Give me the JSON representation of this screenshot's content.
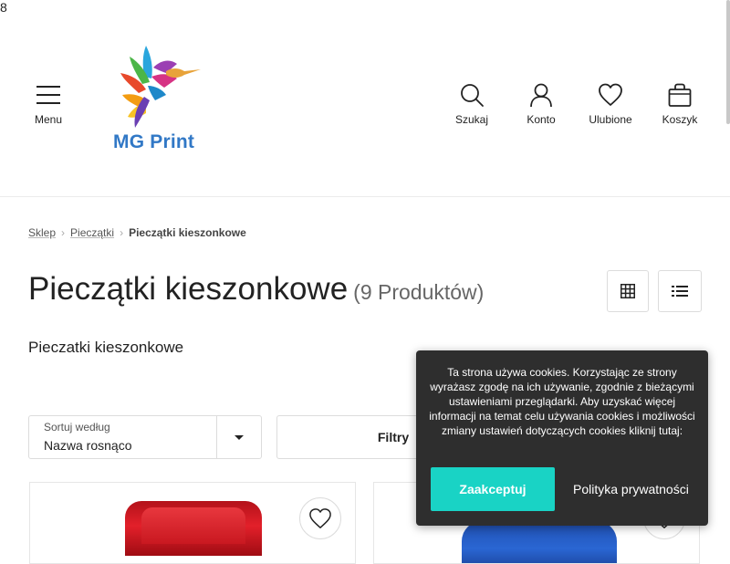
{
  "stray_char": "8",
  "header": {
    "menu_label": "Menu",
    "logo_text": "MG Print",
    "search_label": "Szukaj",
    "account_label": "Konto",
    "favorites_label": "Ulubione",
    "cart_label": "Koszyk"
  },
  "breadcrumb": {
    "items": [
      "Sklep",
      "Pieczątki"
    ],
    "current": "Pieczątki kieszonkowe"
  },
  "page": {
    "title": "Pieczątki kieszonkowe",
    "count": "(9 Produktów)",
    "description": "Pieczatki kieszonkowe"
  },
  "sort": {
    "label": "Sortuj według",
    "value": "Nazwa rosnąco"
  },
  "filters_label": "Filtry",
  "cookie": {
    "text": "Ta strona używa cookies. Korzystając ze strony wyrażasz zgodę na ich używanie, zgodnie z bieżącymi ustawieniami przeglądarki. Aby uzyskać więcej informacji na temat celu używania cookies i możliwości zmiany ustawień dotyczących cookies kliknij tutaj:",
    "accept_label": "Zaakceptuj",
    "privacy_label": "Polityka prywatności"
  },
  "colors": {
    "accent": "#19d3c5",
    "brand": "#3178c6",
    "cookie_bg": "#2e2e2e"
  }
}
